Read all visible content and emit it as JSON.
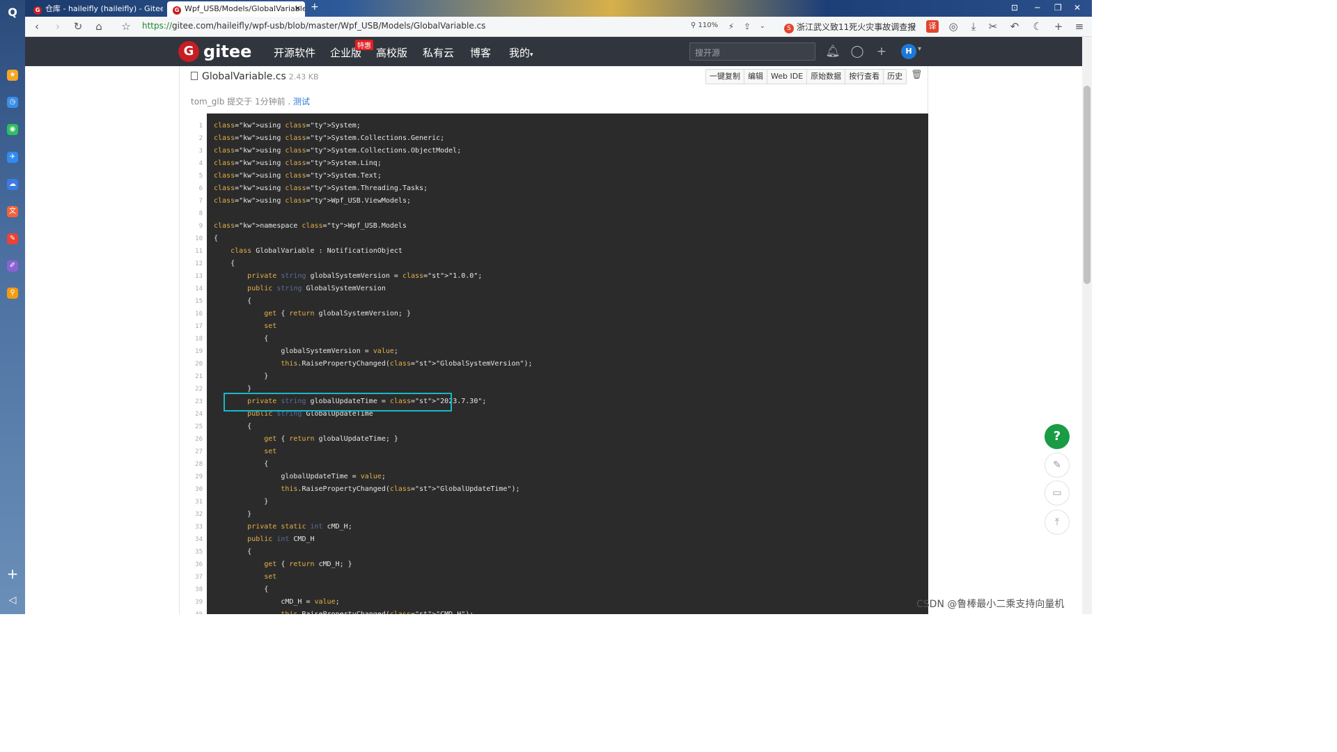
{
  "browser": {
    "tabs": [
      {
        "label": "仓库 - haileifly (haileifly) - Gitee.com"
      },
      {
        "label": "Wpf_USB/Models/GlobalVariable"
      }
    ],
    "url_scheme": "https://",
    "url_rest": "gitee.com/haileifly/wpf-usb/blob/master/Wpf_USB/Models/GlobalVariable.cs",
    "zoom": "110%",
    "news": "浙江武义致11死火灾事故调查报告"
  },
  "gitee": {
    "logo": "gitee",
    "menu": [
      "开源软件",
      "企业版",
      "高校版",
      "私有云",
      "博客",
      "我的"
    ],
    "badge": "特惠",
    "search_placeholder": "搜开源",
    "avatar": "H"
  },
  "file": {
    "name": "GlobalVariable.cs",
    "size": "2.43 KB",
    "actions": [
      "一键复制",
      "编辑",
      "Web IDE",
      "原始数据",
      "按行查看",
      "历史"
    ],
    "commit_author": "tom_glb",
    "commit_text": " 提交于 1分钟前 . ",
    "commit_msg": "测试"
  },
  "code_lines": [
    "using System;",
    "using System.Collections.Generic;",
    "using System.Collections.ObjectModel;",
    "using System.Linq;",
    "using System.Text;",
    "using System.Threading.Tasks;",
    "using Wpf_USB.ViewModels;",
    "",
    "namespace Wpf_USB.Models",
    "{",
    "    class GlobalVariable : NotificationObject",
    "    {",
    "        private string globalSystemVersion = \"1.0.0\";",
    "        public string GlobalSystemVersion",
    "        {",
    "            get { return globalSystemVersion; }",
    "            set",
    "            {",
    "                globalSystemVersion = value;",
    "                this.RaisePropertyChanged(\"GlobalSystemVersion\");",
    "            }",
    "        }",
    "        private string globalUpdateTime = \"2023.7.30\";",
    "        public string GlobalUpdateTime",
    "        {",
    "            get { return globalUpdateTime; }",
    "            set",
    "            {",
    "                globalUpdateTime = value;",
    "                this.RaisePropertyChanged(\"GlobalUpdateTime\");",
    "            }",
    "        }",
    "        private static int cMD_H;",
    "        public int CMD_H",
    "        {",
    "            get { return cMD_H; }",
    "            set",
    "            {",
    "                cMD_H = value;",
    "                this.RaisePropertyChanged(\"CMD_H\");"
  ],
  "watermark": "CSDN @鲁棒最小二乘支持向量机"
}
